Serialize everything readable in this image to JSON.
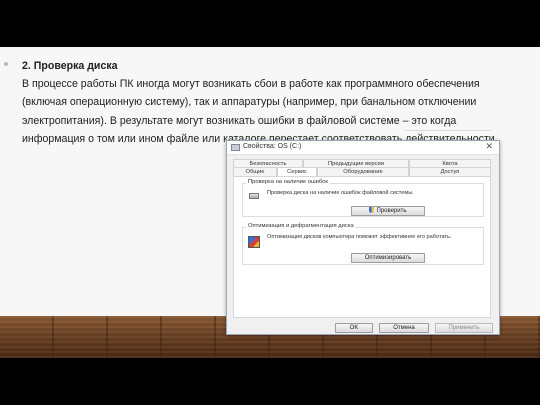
{
  "slide": {
    "heading": "2. Проверка диска",
    "paragraph": "В процессе работы ПК иногда могут возникать сбои в работе как программного обеспечения (включая операционную систему), так и аппаратуры (например, при банальном отключении электропитания). В результате могут возникать ошибки в файловой системе – это когда информация о том или ином файле или каталоге перестает соответствовать действительности."
  },
  "dialog": {
    "title": "Свойства: OS (C:)",
    "close_glyph": "✕",
    "tabs_row1": [
      "Безопасность",
      "Предыдущие версии",
      "Квота"
    ],
    "tabs_row2": [
      "Общие",
      "Сервис",
      "Оборудование",
      "Доступ"
    ],
    "active_tab": "Сервис",
    "check_group": {
      "title": "Проверка на наличие ошибок",
      "description": "Проверка диска на наличие ошибок файловой системы.",
      "button": "Проверить"
    },
    "optimize_group": {
      "title": "Оптимизация и дефрагментация диска",
      "description": "Оптимизация дисков компьютера поможет эффективнее его работать.",
      "button": "Оптимизировать"
    },
    "ok_button": "OK",
    "cancel_button": "Отмена",
    "apply_button": "Применить"
  },
  "colors": {
    "slide_background": "#f7f7f7",
    "floor_wood": "#6b4125",
    "dialog_background": "#f0f0f0"
  }
}
